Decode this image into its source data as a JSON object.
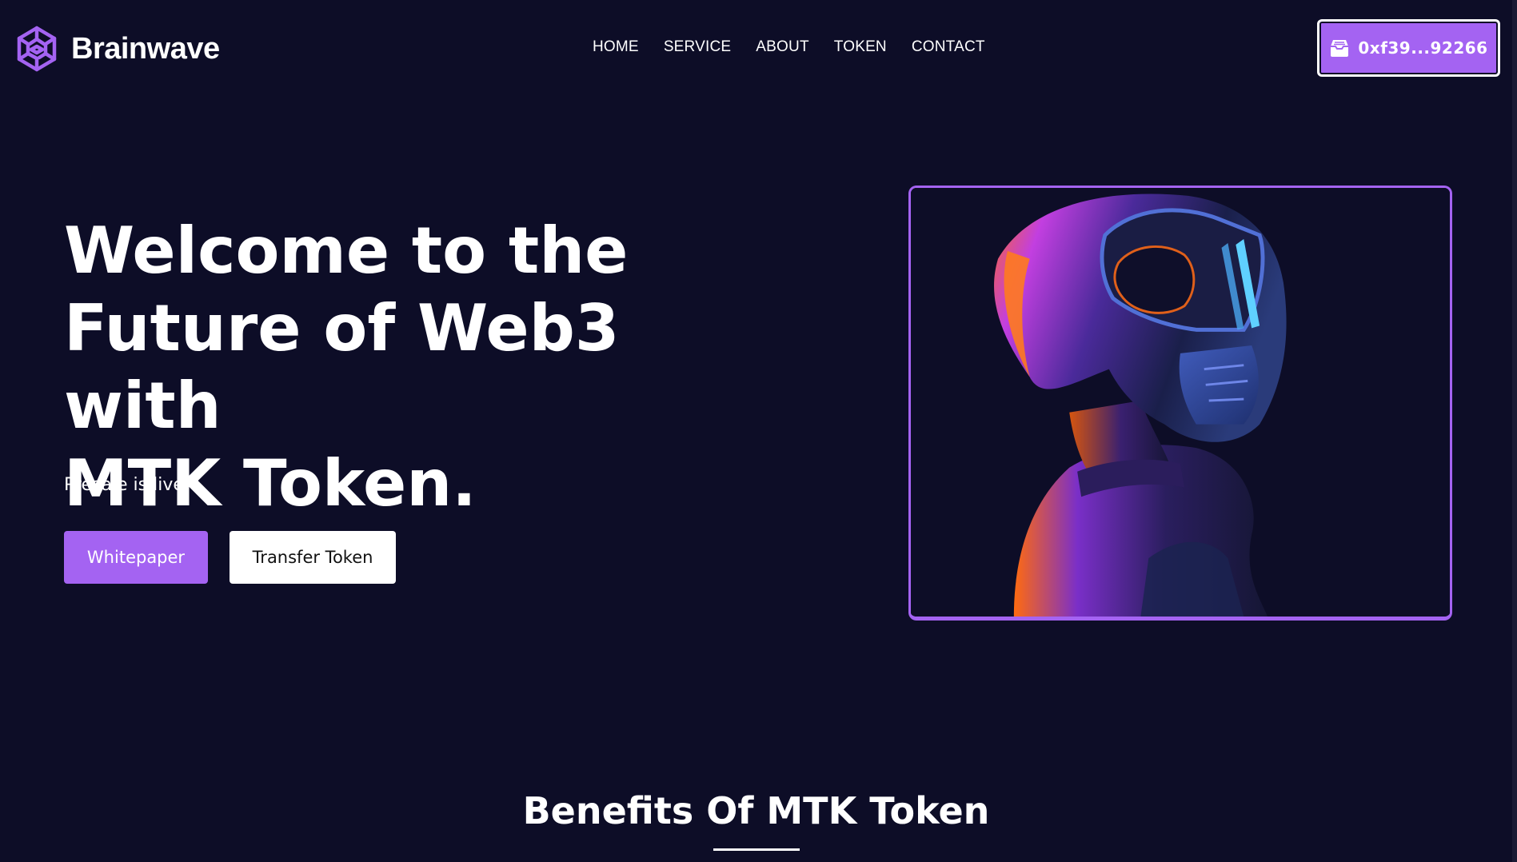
{
  "brand": {
    "name": "Brainwave",
    "logo_icon": "brain-circuit-icon"
  },
  "nav": {
    "items": [
      {
        "label": "HOME"
      },
      {
        "label": "SERVICE"
      },
      {
        "label": "ABOUT"
      },
      {
        "label": "TOKEN"
      },
      {
        "label": "CONTACT"
      }
    ]
  },
  "wallet": {
    "label": "0xf39...92266",
    "icon": "wallet-icon"
  },
  "hero": {
    "title_line1": "Welcome to the",
    "title_line2": "Future of Web3 with",
    "title_line3": "MTK Token.",
    "subtitle": "Presale is live",
    "primary_button": "Whitepaper",
    "secondary_button": "Transfer Token",
    "image": "helmet-figure-illustration"
  },
  "benefits": {
    "title": "Benefits Of MTK Token"
  },
  "colors": {
    "background": "#0d0d27",
    "accent": "#a463f2",
    "text": "#ffffff"
  }
}
